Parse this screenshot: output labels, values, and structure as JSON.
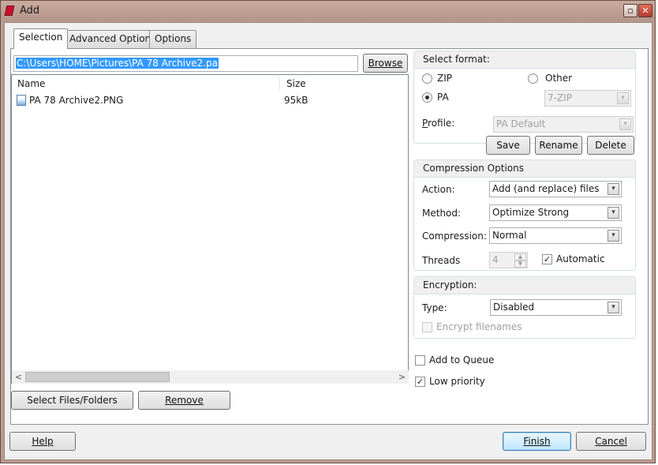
{
  "window": {
    "title": "Add",
    "maximize_glyph": "▫",
    "close_glyph": "✕"
  },
  "tabs": [
    {
      "label": "Selection"
    },
    {
      "label": "Advanced Options"
    },
    {
      "label": "Options"
    }
  ],
  "path_input": {
    "value": "C:\\Users\\HOME\\Pictures\\PA 78 Archive2.pa"
  },
  "browse_label": "Browse",
  "file_list": {
    "columns": [
      "Name",
      "Size"
    ],
    "rows": [
      {
        "name": "PA 78 Archive2.PNG",
        "size": "95kB"
      }
    ],
    "scroll_left": "<",
    "scroll_right": ">"
  },
  "select_files_label": "Select Files/Folders",
  "remove_label": "Remove",
  "format": {
    "title": "Select format:",
    "zip_label": "ZIP",
    "other_label": "Other",
    "pa_label": "PA",
    "other_value": "7-ZIP",
    "selected": "PA"
  },
  "profile": {
    "label": "Profile:",
    "value": "PA Default",
    "save_label": "Save",
    "rename_label": "Rename",
    "delete_label": "Delete"
  },
  "compression": {
    "title": "Compression Options",
    "action_label": "Action:",
    "action_value": "Add (and replace) files",
    "method_label": "Method:",
    "method_value": "Optimize Strong",
    "compression_label": "Compression:",
    "compression_value": "Normal",
    "threads_label": "Threads",
    "threads_value": "4",
    "automatic_label": "Automatic",
    "automatic_checked": true
  },
  "encryption": {
    "title": "Encryption:",
    "type_label": "Type:",
    "type_value": "Disabled",
    "encrypt_filenames_label": "Encrypt filenames",
    "encrypt_filenames_checked": false
  },
  "add_to_queue": {
    "label": "Add to Queue",
    "checked": false
  },
  "low_priority": {
    "label": "Low priority",
    "checked": true
  },
  "help_label": "Help",
  "finish_label": "Finish",
  "cancel_label": "Cancel",
  "glyphs": {
    "dropdown": "▾",
    "check": "✓",
    "spin_up": "▲",
    "spin_down": "▼"
  }
}
